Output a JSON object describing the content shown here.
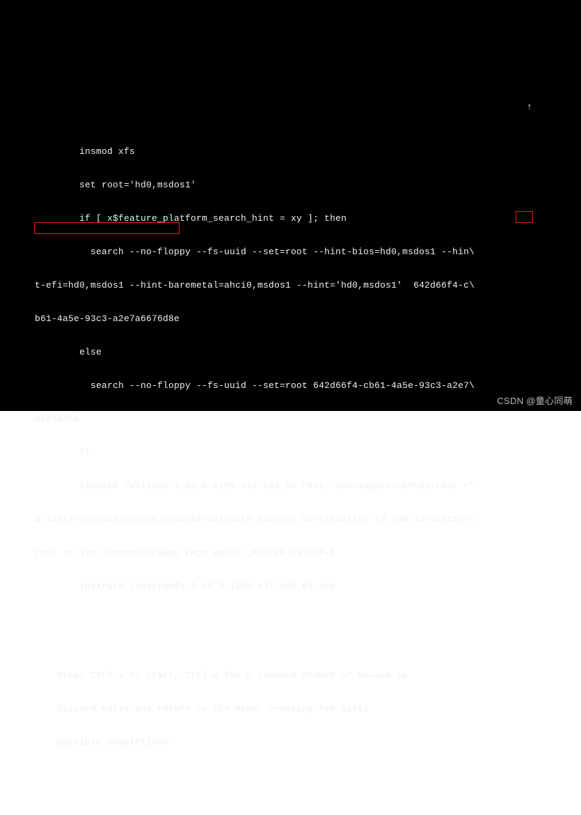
{
  "grub": {
    "lines": [
      "        insmod xfs",
      "        set root='hd0,msdos1'",
      "        if [ x$feature_platform_search_hint = xy ]; then",
      "          search --no-floppy --fs-uuid --set=root --hint-bios=hd0,msdos1 --hin\\",
      "t-efi=hd0,msdos1 --hint-baremetal=ahci0,msdos1 --hint='hd0,msdos1'  642d66f4-c\\",
      "b61-4a5e-93c3-a2e7a6676d8e",
      "        else",
      "          search --no-floppy --fs-uuid --set=root 642d66f4-cb61-4a5e-93c3-a2e7\\",
      "a6676d8e",
      "        fi",
      "        linux16 /vmlinuz-3.10.0-1160.el7.x86_64 root=/dev/mapper/centos-root r\\",
      "w init=/sysroot/bin/sh crashkernel=auto spectre_v2=retpoline rd.lvm.lv=centos/\\",
      "root rd.lvm.lv=centos/swap rhgb quiet LANG=zh_CN.UTF-8",
      "        initrd16 /initramfs-3.10.0-1160.el7.x86_64.img"
    ],
    "highlight1": "r\\",
    "highlight2": "w init=/sysroot/bin/sh",
    "scroll_indicator": "↑",
    "help": [
      "Press Ctrl-x to start, Ctrl-c for a command prompt or Escape to",
      "discard edits and return to the menu. Pressing Tab lists",
      "possible completions."
    ]
  },
  "watermark": "CSDN @童心同萌"
}
